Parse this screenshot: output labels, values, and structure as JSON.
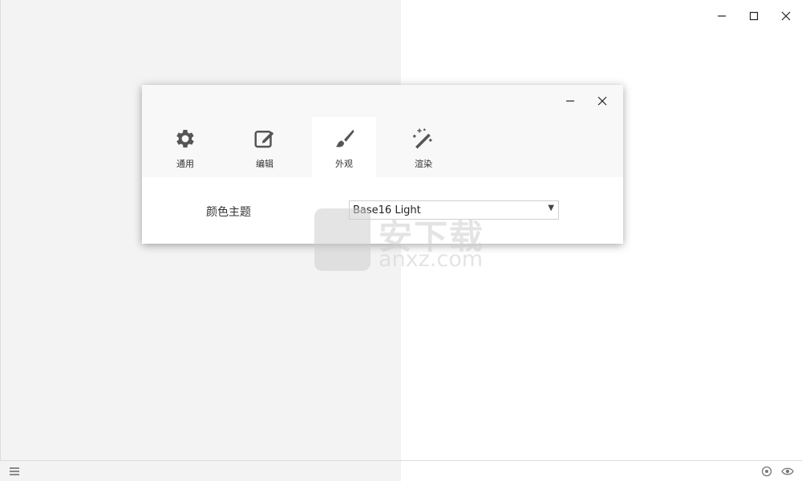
{
  "window": {
    "controls": [
      "minimize",
      "maximize",
      "close"
    ]
  },
  "dialog": {
    "tabs": [
      {
        "label": "通用",
        "icon": "gear-icon",
        "active": false
      },
      {
        "label": "编辑",
        "icon": "edit-icon",
        "active": false
      },
      {
        "label": "外观",
        "icon": "brush-icon",
        "active": true
      },
      {
        "label": "渲染",
        "icon": "magic-wand-icon",
        "active": false
      }
    ],
    "setting": {
      "label": "颜色主题",
      "value": "Base16 Light"
    }
  },
  "statusbar": {
    "left_icon": "menu-icon",
    "right_icons": [
      "settings-icon",
      "eye-icon"
    ]
  },
  "watermark": {
    "cn": "安下载",
    "en": "anxz.com"
  },
  "colors": {
    "editor_bg": "#f3f3f3",
    "dialog_header_bg": "#f8f8f8",
    "icon": "#555555"
  }
}
